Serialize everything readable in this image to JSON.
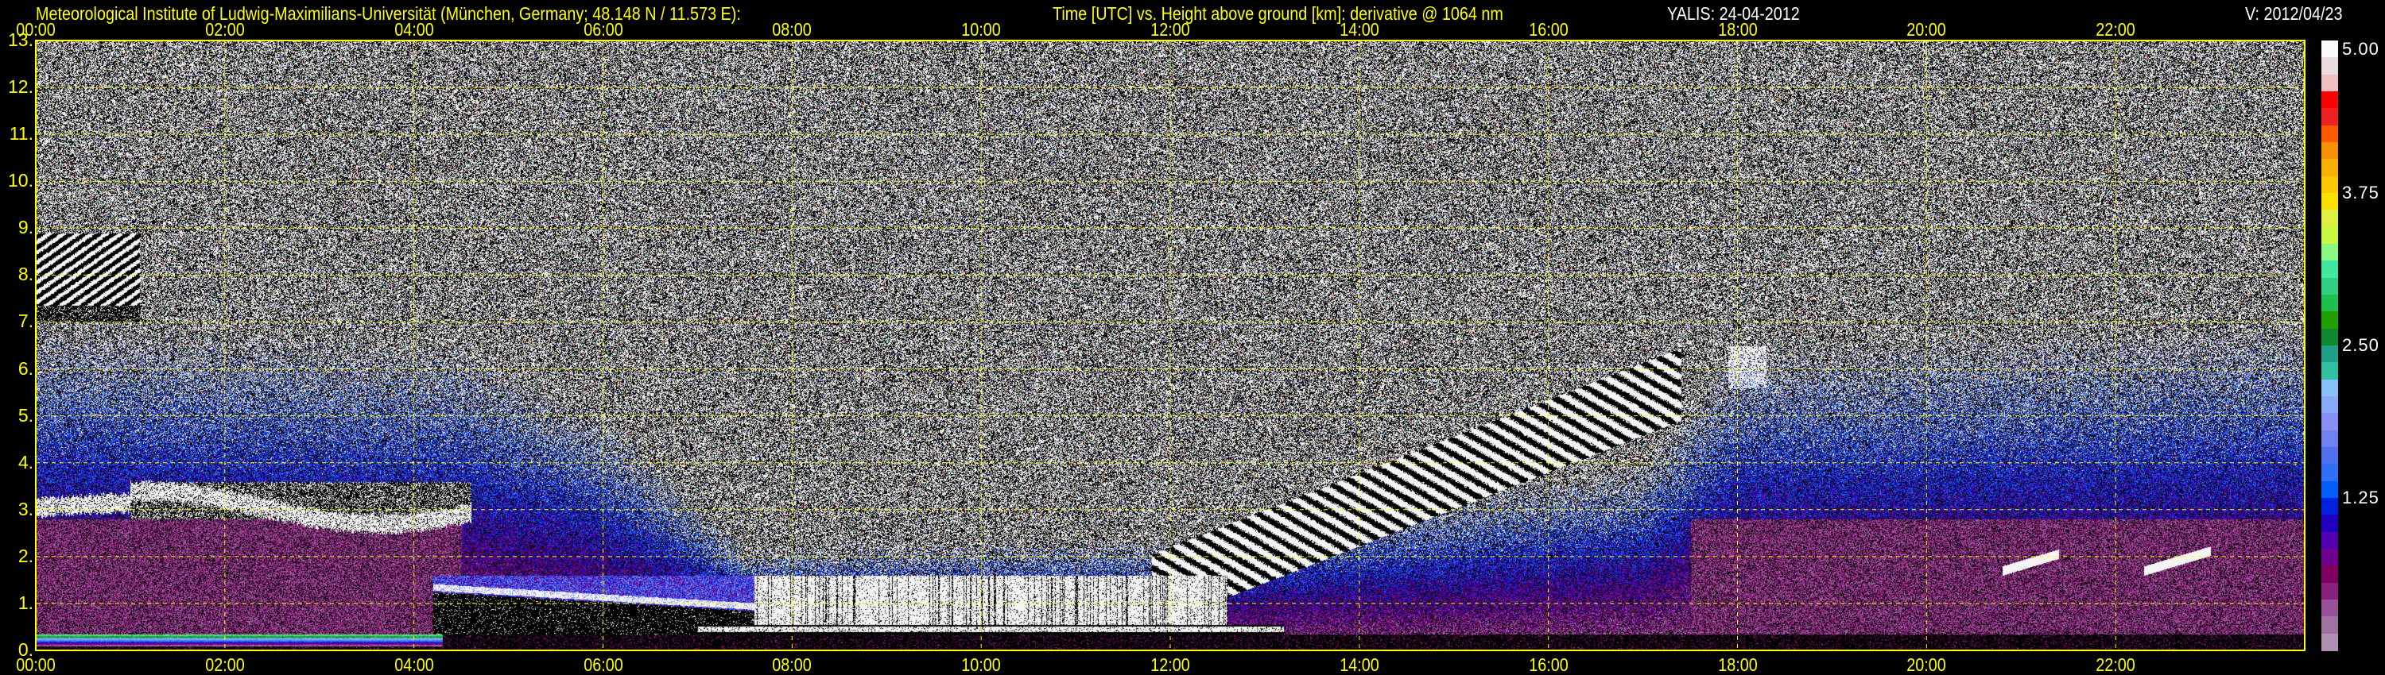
{
  "header": {
    "institute": "Meteorological Institute of Ludwig-Maximilians-Universität (München, Germany; 48.148 N / 11.573 E):",
    "axes_description": "Time [UTC] vs. Height above ground [km]: derivative @ 1064 nm",
    "instrument_date": "YALIS: 24-04-2012",
    "version": "V: 2012/04/23"
  },
  "colors": {
    "axis": "#ffff00",
    "noise_white": "#f4f4f4",
    "background": "#000000"
  },
  "chart_data": {
    "type": "heatmap",
    "title": "Time [UTC] vs. Height above ground [km]: derivative @ 1064 nm",
    "xlabel": "Time [UTC]",
    "ylabel": "Height above ground [km]",
    "xlim": [
      0,
      24
    ],
    "ylim": [
      0,
      13
    ],
    "grid": true,
    "xticks": [
      "00:00",
      "02:00",
      "04:00",
      "06:00",
      "08:00",
      "10:00",
      "12:00",
      "14:00",
      "16:00",
      "18:00",
      "20:00",
      "22:00"
    ],
    "yticks": [
      "0.",
      "1.",
      "2.",
      "3.",
      "4.",
      "5.",
      "6.",
      "7.",
      "8.",
      "9.",
      "10.",
      "11.",
      "12.",
      "13."
    ],
    "colorbar": {
      "range": [
        0,
        5
      ],
      "ticks": [
        "5.00",
        "3.75",
        "2.50",
        "1.25"
      ],
      "colors_top_to_bottom": [
        "#fafafa",
        "#e8dcdc",
        "#f0c0c0",
        "#ff0000",
        "#ee2020",
        "#ff5a00",
        "#f89000",
        "#f8b000",
        "#fcc800",
        "#f8e000",
        "#e0f040",
        "#c8f840",
        "#88f880",
        "#40e8a0",
        "#30d080",
        "#20c050",
        "#20a000",
        "#108830",
        "#20a088",
        "#30c0a0",
        "#88c0f8",
        "#88a8f8",
        "#8890f8",
        "#7080f0",
        "#5070f0",
        "#3070f8",
        "#0060ff",
        "#0020e0",
        "#2000c0",
        "#5000b0",
        "#700090",
        "#800060",
        "#882080",
        "#985098",
        "#a070a0",
        "#b090b0"
      ]
    }
  }
}
